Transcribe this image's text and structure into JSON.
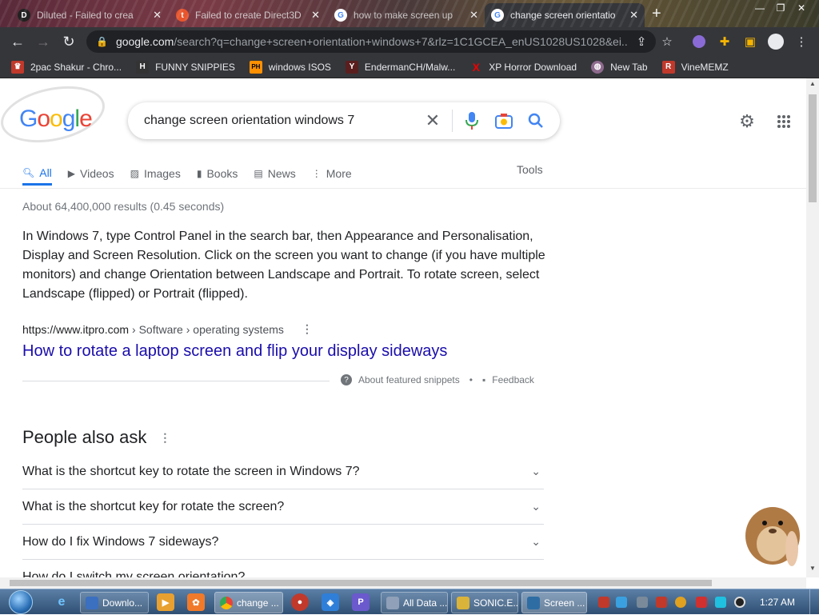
{
  "browser": {
    "tabs": [
      {
        "title": "Diluted - Failed to crea",
        "favicon": "D",
        "color": "#222"
      },
      {
        "title": "Failed to create Direct3D",
        "favicon": "t",
        "color": "#e8552d"
      },
      {
        "title": "how to make screen up",
        "favicon": "G",
        "color": "#4285f4"
      },
      {
        "title": "change screen orientatio",
        "favicon": "G",
        "color": "#4285f4"
      }
    ],
    "url_host": "google.com",
    "url_rest": "/search?q=change+screen+orientation+windows+7&rlz=1C1GCEA_enUS1028US1028&ei...",
    "bookmarks": [
      {
        "label": "2pac Shakur - Chro...",
        "icon": "♛",
        "color": "#c0392b"
      },
      {
        "label": "FUNNY SNIPPIES",
        "icon": "H",
        "color": "#333"
      },
      {
        "label": "windows ISOS",
        "icon": "PH",
        "color": "#ff9000"
      },
      {
        "label": "EndermanCH/Malw...",
        "icon": "Y",
        "color": "#5a1e1e"
      },
      {
        "label": "XP Horror Download",
        "icon": "X",
        "color": "#e00"
      },
      {
        "label": "New Tab",
        "icon": "◍",
        "color": "#8e6b8e"
      },
      {
        "label": "VineMEMZ",
        "icon": "R",
        "color": "#c0392b"
      }
    ]
  },
  "google": {
    "query": "change screen orientation windows 7",
    "tabs": [
      "All",
      "Videos",
      "Images",
      "Books",
      "News",
      "More"
    ],
    "tools": "Tools",
    "stats": "About 64,400,000 results (0.45 seconds)",
    "snippet": "In Windows 7, type Control Panel in the search bar, then Appearance and Personalisation, Display and Screen Resolution. Click on the screen you want to change (if you have multiple monitors) and change Orientation between Landscape and Portrait. To rotate screen, select Landscape (flipped) or Portrait (flipped).",
    "cite_domain": "https://www.itpro.com",
    "cite_path": " › Software › operating systems",
    "result_title": "How to rotate a laptop screen and flip your display sideways",
    "about_snippets": "About featured snippets",
    "separator": "•",
    "feedback": "Feedback",
    "paa_title": "People also ask",
    "questions": [
      "What is the shortcut key to rotate the screen in Windows 7?",
      "What is the shortcut key for rotate the screen?",
      "How do I fix Windows 7 sideways?",
      "How do I switch my screen orientation?"
    ]
  },
  "taskbar": {
    "buttons": [
      {
        "label": "Downlo...",
        "color": "#3b6fc0"
      },
      {
        "label": "change ...",
        "color": "#4285f4"
      },
      {
        "label": "All Data ...",
        "color": "#8fa0b8"
      },
      {
        "label": "SONIC.E...",
        "color": "#d9b33a"
      },
      {
        "label": "Screen ...",
        "color": "#2e6da4"
      }
    ],
    "clock": "1:27 AM"
  }
}
